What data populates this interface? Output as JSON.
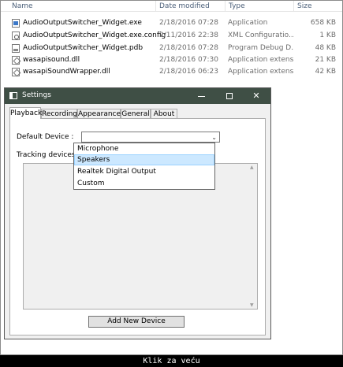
{
  "explorer": {
    "columns": {
      "name": "Name",
      "date": "Date modified",
      "type": "Type",
      "size": "Size"
    },
    "files": [
      {
        "icon": "exe-file-icon",
        "name": "AudioOutputSwitcher_Widget.exe",
        "date": "2/18/2016 07:28",
        "type": "Application",
        "size": "658 KB"
      },
      {
        "icon": "config-file-icon",
        "name": "AudioOutputSwitcher_Widget.exe.config",
        "date": "2/11/2016 22:38",
        "type": "XML Configuratio...",
        "size": "1 KB"
      },
      {
        "icon": "pdb-file-icon",
        "name": "AudioOutputSwitcher_Widget.pdb",
        "date": "2/18/2016 07:28",
        "type": "Program Debug D...",
        "size": "48 KB"
      },
      {
        "icon": "dll-file-icon",
        "name": "wasapisound.dll",
        "date": "2/18/2016 07:30",
        "type": "Application extens...",
        "size": "21 KB"
      },
      {
        "icon": "dll-file-icon",
        "name": "wasapiSoundWrapper.dll",
        "date": "2/18/2016 06:23",
        "type": "Application extens...",
        "size": "42 KB"
      }
    ]
  },
  "window": {
    "title": "Settings",
    "controls": {
      "minimize": "minimize-icon",
      "maximize": "maximize-icon",
      "close": "✕"
    },
    "tabs": [
      "Playback",
      "Recording",
      "Appearance",
      "General",
      "About"
    ],
    "active_tab": "Playback",
    "playback": {
      "default_device_label": "Default Device :",
      "default_device_value": "",
      "tracking_devices_label": "Tracking devices :",
      "dropdown_options": [
        "Microphone",
        "Speakers",
        "Realtek Digital Output",
        "Custom"
      ],
      "highlighted_option": "Speakers",
      "add_button": "Add New Device"
    }
  },
  "caption": "Klik za veću",
  "colors": {
    "titlebar": "#3f4f45",
    "selection": "#cce8ff",
    "selection_border": "#99d1ff"
  }
}
